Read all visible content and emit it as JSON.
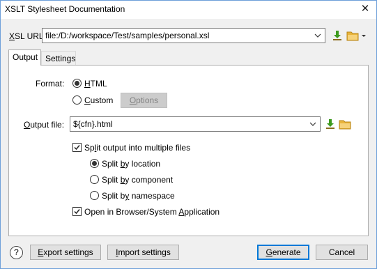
{
  "window": {
    "title": "XSLT Stylesheet Documentation",
    "close_glyph": "✕"
  },
  "xsl_url": {
    "label_u": "X",
    "label_rest": "SL URL:",
    "value": "file:/D:/workspace/Test/samples/personal.xsl",
    "icons": [
      "insert-editor-variables-icon",
      "browse-folder-icon",
      "dropdown-arrow-icon"
    ]
  },
  "tabs": [
    {
      "label": "Output",
      "active": true
    },
    {
      "label": "Settings",
      "active": false
    }
  ],
  "format": {
    "label": "Format:",
    "html_u": "H",
    "html_rest": "TML",
    "custom_u": "C",
    "custom_rest": "ustom",
    "options_button_u": "O",
    "options_button_rest": "ptions",
    "selected": "HTML"
  },
  "output_file": {
    "label_u": "O",
    "label_rest": "utput file:",
    "value": "${cfn}.html"
  },
  "split": {
    "checkbox_pre": "Sp",
    "checkbox_u": "l",
    "checkbox_rest": "it output into multiple files",
    "checked": true,
    "by_location_pre": "Split ",
    "by_location_u": "b",
    "by_location_rest": "y location",
    "by_component_pre": "Split ",
    "by_component_u": "b",
    "by_component_rest": "y component",
    "by_namespace_pre": "Split b",
    "by_namespace_u": "y",
    "by_namespace_rest": " namespace",
    "selected": "location"
  },
  "open_browser": {
    "pre": "Open in Browser/System ",
    "u": "A",
    "rest": "pplication",
    "checked": true
  },
  "footer": {
    "help_glyph": "?",
    "export_u": "E",
    "export_rest": "xport settings",
    "import_u": "I",
    "import_rest": "mport settings",
    "generate_u": "G",
    "generate_rest": "enerate",
    "cancel": "Cancel"
  },
  "colors": {
    "accent_border": "#0078d7",
    "window_border": "#6d9fd9",
    "arrow_green": "#3c9a1e",
    "folder_yellow": "#e8b43b"
  }
}
